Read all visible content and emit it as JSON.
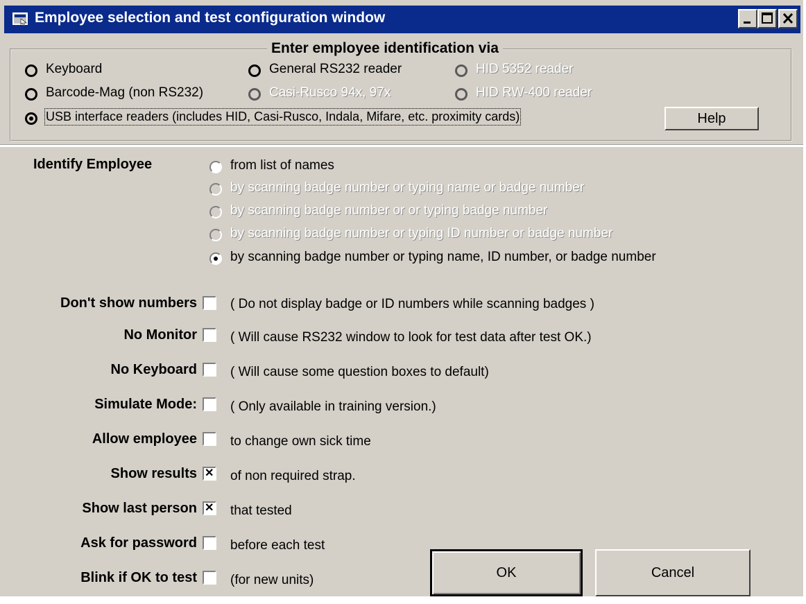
{
  "window": {
    "title": "Employee selection and test configuration window"
  },
  "id_source": {
    "legend": "Enter employee identification via",
    "options": [
      {
        "label": "Keyboard",
        "selected": false,
        "enabled": true
      },
      {
        "label": "General RS232 reader",
        "selected": false,
        "enabled": true
      },
      {
        "label": "HID 5352 reader",
        "selected": false,
        "enabled": false
      },
      {
        "label": "Barcode-Mag (non RS232)",
        "selected": false,
        "enabled": true
      },
      {
        "label": "Casi-Rusco 94x, 97x",
        "selected": false,
        "enabled": false
      },
      {
        "label": "HID RW-400 reader",
        "selected": false,
        "enabled": false
      },
      {
        "label": "USB interface readers (includes HID, Casi-Rusco, Indala, Mifare, etc. proximity cards)",
        "selected": true,
        "enabled": true
      }
    ],
    "help_label": "Help"
  },
  "identify": {
    "heading": "Identify  Employee",
    "options": [
      {
        "label": "from list of names",
        "selected": false,
        "enabled": true
      },
      {
        "label": "by scanning badge number or typing name or badge number",
        "selected": false,
        "enabled": false
      },
      {
        "label": "by scanning badge number or or typing badge number",
        "selected": false,
        "enabled": false
      },
      {
        "label": "by scanning badge number or typing ID number or badge number",
        "selected": false,
        "enabled": false
      },
      {
        "label": "by scanning badge number or typing name, ID number, or badge number",
        "selected": true,
        "enabled": true
      }
    ]
  },
  "settings": [
    {
      "label": "Don't show numbers",
      "checked": false,
      "note": "( Do not display badge or ID numbers while scanning badges )"
    },
    {
      "label": "No Monitor",
      "checked": false,
      "note": "( Will cause RS232 window to look for test data after test OK.)"
    },
    {
      "label": "No Keyboard",
      "checked": false,
      "note": "( Will cause some question boxes to default)"
    },
    {
      "label": "Simulate Mode:",
      "checked": false,
      "note": "( Only available in training version.)"
    },
    {
      "label": "Allow employee",
      "checked": false,
      "note": "to change own sick time"
    },
    {
      "label": "Show results",
      "checked": true,
      "note": "of non required strap."
    },
    {
      "label": "Show last person",
      "checked": true,
      "note": "that tested"
    },
    {
      "label": "Ask for password",
      "checked": false,
      "note": "before each test"
    },
    {
      "label": "Blink if OK to test",
      "checked": false,
      "note": "(for new units)"
    }
  ],
  "buttons": {
    "ok": "OK",
    "cancel": "Cancel"
  },
  "colors": {
    "titlebar": "#0a2b8c",
    "face": "#d4d0c8"
  },
  "icons": {
    "window_icon": "app-window-icon",
    "minimize": "minimize-icon",
    "maximize": "maximize-icon",
    "close": "close-icon"
  }
}
